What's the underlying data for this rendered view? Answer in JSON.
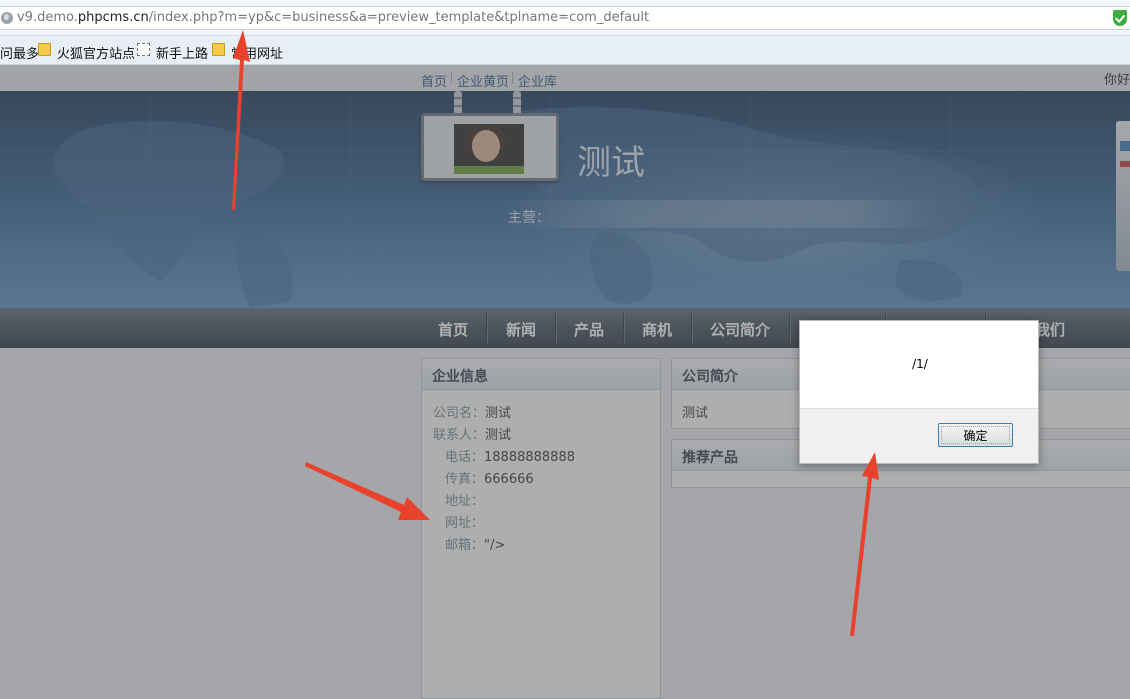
{
  "browser": {
    "url_prefix": "v9.demo.",
    "url_domain": "phpcms.cn",
    "url_path": "/index.php?m=yp&c=business&a=preview_template&tplname=com_default",
    "bookmarks": [
      "问最多",
      "火狐官方站点",
      "新手上路",
      "常用网址"
    ]
  },
  "topnav": {
    "links": [
      "首页",
      "企业黄页",
      "企业库"
    ],
    "greeting": "你好"
  },
  "banner": {
    "site_title": "测试",
    "business_label": "主营："
  },
  "mainnav": {
    "items": [
      "首页",
      "新闻",
      "产品",
      "商机",
      "公司简介",
      "",
      "",
      "联系我们"
    ]
  },
  "company_info": {
    "title": "企业信息",
    "rows": [
      {
        "label": "公司名：",
        "value": "测试"
      },
      {
        "label": "联系人：",
        "value": "测试"
      },
      {
        "label": "电话：",
        "value": "18888888888"
      },
      {
        "label": "传真：",
        "value": "666666"
      },
      {
        "label": "地址：",
        "value": ""
      },
      {
        "label": "网址：",
        "value": ""
      },
      {
        "label": "邮箱：",
        "value": "\"/>"
      }
    ]
  },
  "intro": {
    "title": "公司简介",
    "text": "测试"
  },
  "products": {
    "title": "推荐产品"
  },
  "dialog": {
    "message": "/1/",
    "ok_label": "确定"
  },
  "colors": {
    "arrow": "#e8412c",
    "link": "#2c5a8a",
    "banner_dark": "#18395f"
  }
}
